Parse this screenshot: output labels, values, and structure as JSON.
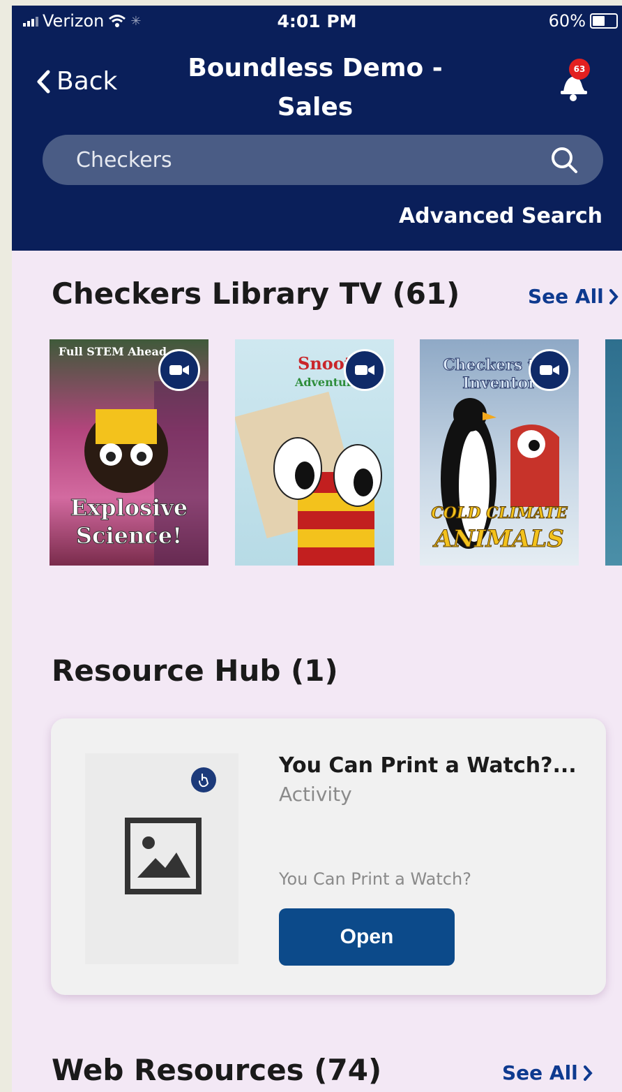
{
  "status_bar": {
    "carrier": "Verizon",
    "time": "4:01 PM",
    "battery": "60%",
    "battery_level": 0.6
  },
  "header": {
    "back_label": "Back",
    "title_line1": "Boundless Demo -",
    "title_line2": "Sales",
    "notification_count": "63",
    "colors": {
      "background": "#0a1f5a",
      "badge": "#e32020"
    }
  },
  "search": {
    "value": "Checkers",
    "advanced_label": "Advanced Search"
  },
  "sections": {
    "library_tv": {
      "title": "Checkers Library TV (61)",
      "see_all": "See All",
      "items": [
        {
          "label_line1": "Explosive",
          "label_line2": "Science!",
          "top_text": "Full STEM Ahead",
          "icon": "video-camera-icon"
        },
        {
          "label_line1": "Snoot",
          "label_line2": "Adventures",
          "icon": "video-camera-icon"
        },
        {
          "label_line1": "COLD CLIMATE",
          "label_line2": "ANIMALS",
          "top_text": "Checkers the Inventor",
          "icon": "video-camera-icon"
        }
      ]
    },
    "resource_hub": {
      "title": "Resource Hub (1)",
      "card": {
        "title": "You Can Print a Watch?...",
        "type": "Activity",
        "description": "You Can Print a Watch?",
        "button": "Open",
        "icon": "image-placeholder-icon"
      }
    },
    "web_resources": {
      "title": "Web Resources (74)",
      "see_all": "See All"
    }
  }
}
